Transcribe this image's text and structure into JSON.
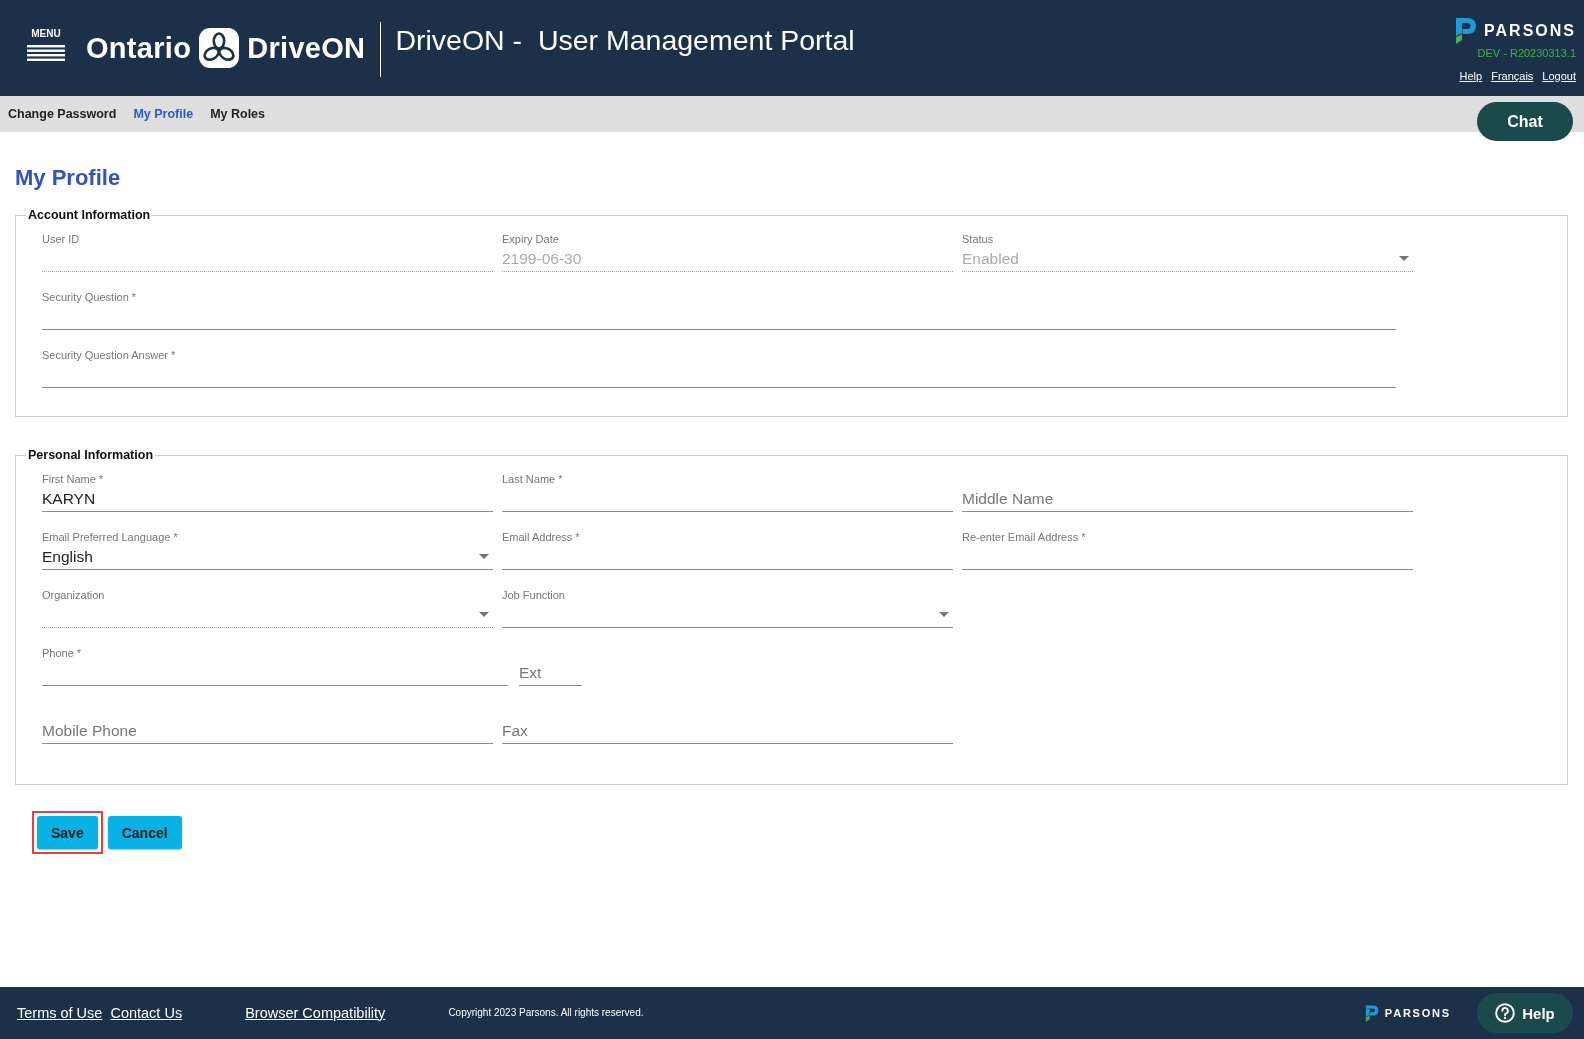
{
  "header": {
    "menu": {
      "label": "MENU"
    },
    "logo": {
      "left_text": "Ontario",
      "right_text": "DriveON"
    },
    "title": "DriveON -  User Management Portal",
    "brand": {
      "name": "PARSONS",
      "version": "DEV - R20230313.1"
    },
    "links": [
      "Help",
      "Français",
      "Logout"
    ]
  },
  "nav": {
    "items": [
      {
        "label": "Change Password",
        "selected": false
      },
      {
        "label": "My Profile",
        "selected": true
      },
      {
        "label": "My Roles",
        "selected": false
      }
    ]
  },
  "chat_button": {
    "label": "Chat"
  },
  "page_title": "My Profile",
  "sections": [
    {
      "legend": "Account Information",
      "rows": [
        {
          "kind": "columns",
          "fields": [
            {
              "kind": "text",
              "label": "User ID",
              "disabled": true
            },
            {
              "kind": "text",
              "label": "Expiry Date",
              "value": "2199-06-30",
              "disabled": true
            },
            {
              "kind": "select",
              "label": "Status",
              "value": "Enabled",
              "disabled": true
            }
          ]
        },
        {
          "kind": "wide",
          "fields": [
            {
              "kind": "text",
              "label": "Security Question *",
              "disabled": false
            }
          ]
        },
        {
          "kind": "wide",
          "fields": [
            {
              "kind": "text",
              "label": "Security Question Answer *",
              "disabled": false
            }
          ]
        }
      ]
    },
    {
      "legend": "Personal Information",
      "rows": [
        {
          "kind": "columns",
          "fields": [
            {
              "kind": "text",
              "label": "First Name *",
              "value": "KARYN",
              "disabled": false
            },
            {
              "kind": "text",
              "label": "Last Name *",
              "disabled": false
            },
            {
              "kind": "text",
              "placeholder": "Middle Name",
              "disabled": false
            }
          ]
        },
        {
          "kind": "columns",
          "fields": [
            {
              "kind": "select",
              "label": "Email Preferred Language *",
              "value": "English",
              "disabled": false
            },
            {
              "kind": "text",
              "label": "Email Address *",
              "disabled": false
            },
            {
              "kind": "text",
              "label": "Re-enter Email Address *",
              "disabled": false
            }
          ]
        },
        {
          "kind": "columns",
          "fields": [
            {
              "kind": "select",
              "label": "Organization",
              "disabled": true
            },
            {
              "kind": "select",
              "label": "Job Function",
              "disabled": false
            }
          ]
        },
        {
          "kind": "phone",
          "fields": [
            {
              "kind": "text",
              "label": "Phone *",
              "disabled": false
            },
            {
              "kind": "text",
              "placeholder": "Ext",
              "disabled": false
            }
          ]
        },
        {
          "kind": "columns",
          "fields": [
            {
              "kind": "text",
              "placeholder": "Mobile Phone",
              "disabled": false
            },
            {
              "kind": "text",
              "placeholder": "Fax",
              "disabled": false
            }
          ]
        }
      ]
    }
  ],
  "buttons": [
    {
      "label": "Save",
      "highlighted": true
    },
    {
      "label": "Cancel",
      "highlighted": false
    }
  ],
  "footer": {
    "link_groups": [
      [
        "Terms of Use",
        "Contact Us"
      ],
      [
        "Browser Compatibility"
      ]
    ],
    "copyright": "Copyright 2023 Parsons. All rights reserved.",
    "brand": "PARSONS",
    "help_button": {
      "label": "Help"
    }
  }
}
